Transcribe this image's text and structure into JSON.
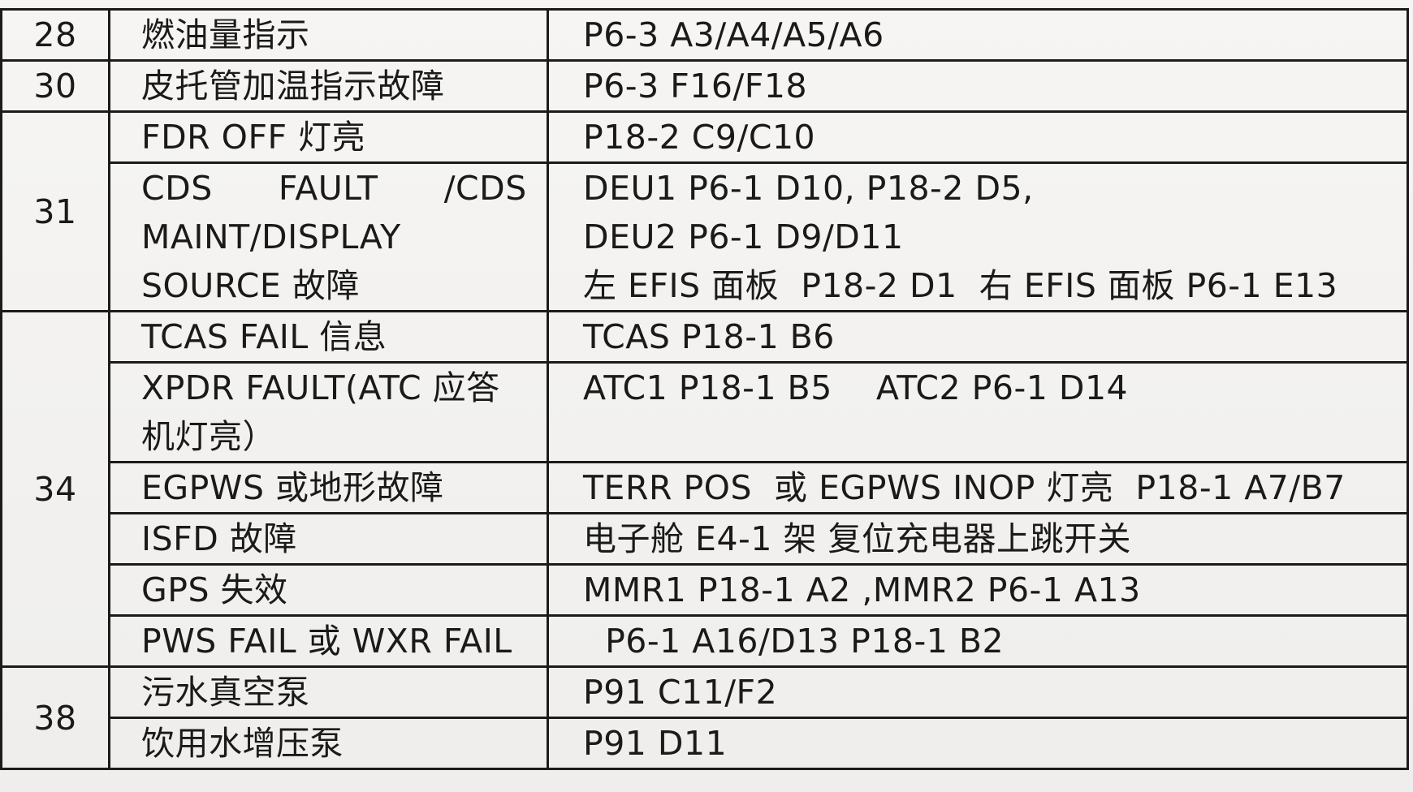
{
  "rows": [
    {
      "ata": "28",
      "item": [
        "燃油量指示"
      ],
      "cb": [
        "P6-3 A3/A4/A5/A6"
      ]
    },
    {
      "ata": "30",
      "item": [
        "皮托管加温指示故障"
      ],
      "cb": [
        "P6-3 F16/F18"
      ]
    },
    {
      "ata": "31",
      "item": [
        "FDR OFF 灯亮"
      ],
      "cb": [
        "P18-2 C9/C10"
      ]
    },
    {
      "ata": "",
      "item": [
        "CDS      FAULT      /CDS",
        "MAINT/DISPLAY",
        "SOURCE 故障"
      ],
      "cb": [
        "DEU1 P6-1 D10, P18-2 D5,",
        "DEU2 P6-1 D9/D11",
        "左 EFIS 面板  P18-2 D1  右 EFIS 面板 P6-1 E13"
      ]
    },
    {
      "ata": "34",
      "item": [
        "TCAS FAIL 信息"
      ],
      "cb": [
        "TCAS P18-1 B6"
      ]
    },
    {
      "ata": "",
      "item": [
        "XPDR FAULT(ATC 应答",
        "机灯亮）"
      ],
      "cb": [
        "ATC1 P18-1 B5    ATC2 P6-1 D14"
      ]
    },
    {
      "ata": "",
      "item": [
        "EGPWS 或地形故障"
      ],
      "cb": [
        "TERR POS  或 EGPWS INOP 灯亮  P18-1 A7/B7"
      ]
    },
    {
      "ata": "",
      "item": [
        "ISFD 故障"
      ],
      "cb": [
        "电子舱 E4-1 架  复位充电器上跳开关"
      ]
    },
    {
      "ata": "",
      "item": [
        "GPS 失效"
      ],
      "cb": [
        "MMR1 P18-1 A2 ,MMR2 P6-1 A13"
      ]
    },
    {
      "ata": "",
      "item": [
        "PWS FAIL 或 WXR FAIL"
      ],
      "cb": [
        "  P6-1 A16/D13 P18-1 B2"
      ]
    },
    {
      "ata": "38",
      "item": [
        "污水真空泵"
      ],
      "cb": [
        "P91 C11/F2"
      ]
    },
    {
      "ata": "",
      "item": [
        "饮用水增压泵"
      ],
      "cb": [
        "P91 D11"
      ]
    }
  ]
}
